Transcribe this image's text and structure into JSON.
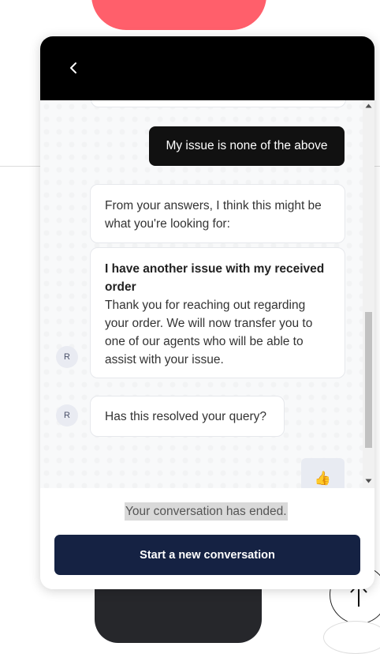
{
  "chat": {
    "messages": {
      "user_message": "My issue is none of the above",
      "bot_intro": "From your answers, I think this might be what you're looking for:",
      "bot_article_title": "I have another issue with my received order",
      "bot_article_body": "Thank you for reaching out regarding your order. We will now transfer you to one of our agents who will be able to assist with your issue.",
      "bot_question": "Has this resolved your query?",
      "avatar_initial": "R"
    },
    "reaction_icon": "thumbs-up",
    "footer": {
      "ended_text": "Your conversation has ended.",
      "new_conversation_label": "Start a new conversation"
    },
    "colors": {
      "header": "#000000",
      "user_bubble": "#111111",
      "primary_button": "#152243",
      "background_top_product": "#ff5f6b"
    }
  }
}
